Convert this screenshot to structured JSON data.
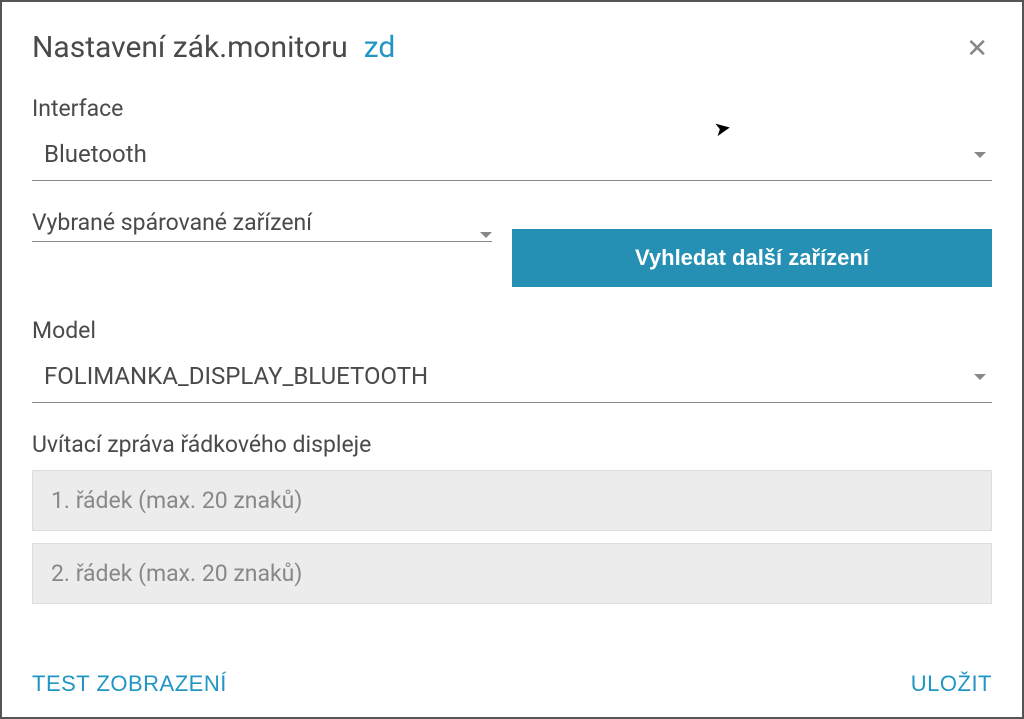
{
  "dialog": {
    "title": "Nastavení zák.monitoru",
    "suffix": "zd"
  },
  "interface": {
    "label": "Interface",
    "value": "Bluetooth"
  },
  "paired": {
    "label": "Vybrané spárované zařízení",
    "searchBtn": "Vyhledat další zařízení"
  },
  "model": {
    "label": "Model",
    "value": "FOLIMANKA_DISPLAY_BLUETOOTH"
  },
  "welcome": {
    "label": "Uvítací zpráva řádkového displeje",
    "line1_placeholder": "1. řádek (max. 20 znaků)",
    "line2_placeholder": "2. řádek (max. 20 znaků)"
  },
  "footer": {
    "test": "TEST ZOBRAZENÍ",
    "save": "ULOŽIT"
  }
}
